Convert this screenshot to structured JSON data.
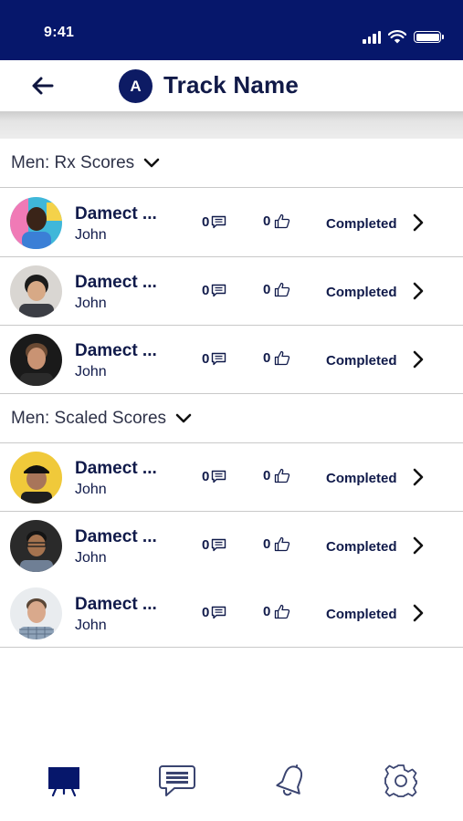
{
  "status_bar": {
    "time": "9:41"
  },
  "header": {
    "avatar_letter": "A",
    "title": "Track Name"
  },
  "sections": [
    {
      "label": "Men: Rx Scores",
      "rows": [
        {
          "name": "Damect ...",
          "sub": "John",
          "comments": "0",
          "likes": "0",
          "status": "Completed"
        },
        {
          "name": "Damect ...",
          "sub": "John",
          "comments": "0",
          "likes": "0",
          "status": "Completed"
        },
        {
          "name": "Damect ...",
          "sub": "John",
          "comments": "0",
          "likes": "0",
          "status": "Completed"
        }
      ]
    },
    {
      "label": "Men: Scaled Scores",
      "rows": [
        {
          "name": "Damect ...",
          "sub": "John",
          "comments": "0",
          "likes": "0",
          "status": "Completed"
        },
        {
          "name": "Damect ...",
          "sub": "John",
          "comments": "0",
          "likes": "0",
          "status": "Completed"
        },
        {
          "name": "Damect ...",
          "sub": "John",
          "comments": "0",
          "likes": "0",
          "status": "Completed"
        }
      ]
    }
  ],
  "bottom_nav": [
    {
      "icon": "whiteboard-icon",
      "active": true
    },
    {
      "icon": "chat-icon",
      "active": false
    },
    {
      "icon": "bell-icon",
      "active": false
    },
    {
      "icon": "gear-icon",
      "active": false
    }
  ],
  "colors": {
    "primary": "#06176b",
    "text": "#101a4a",
    "divider": "#c9c9c9",
    "icon_inactive": "#3a4470"
  }
}
